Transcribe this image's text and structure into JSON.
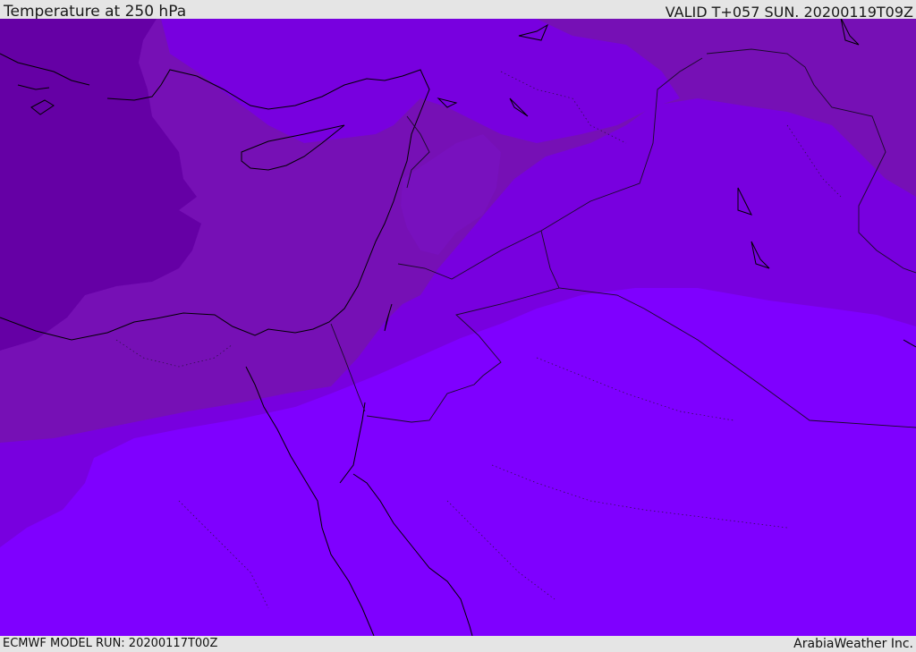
{
  "header": {
    "title": "Temperature at 250 hPa",
    "valid": "VALID T+057 SUN. 20200119T09Z"
  },
  "footer": {
    "model_run": "ECMWF MODEL RUN: 20200117T00Z",
    "credit": "ArabiaWeather Inc."
  },
  "map": {
    "field": "Temperature at 250 hPa",
    "colors": {
      "darkest": "#6500a5",
      "dark": "#7610b5",
      "medium": "#7800df",
      "light": "#7f00ff",
      "coastline": "#000000",
      "border": "#3a1a5a"
    }
  }
}
